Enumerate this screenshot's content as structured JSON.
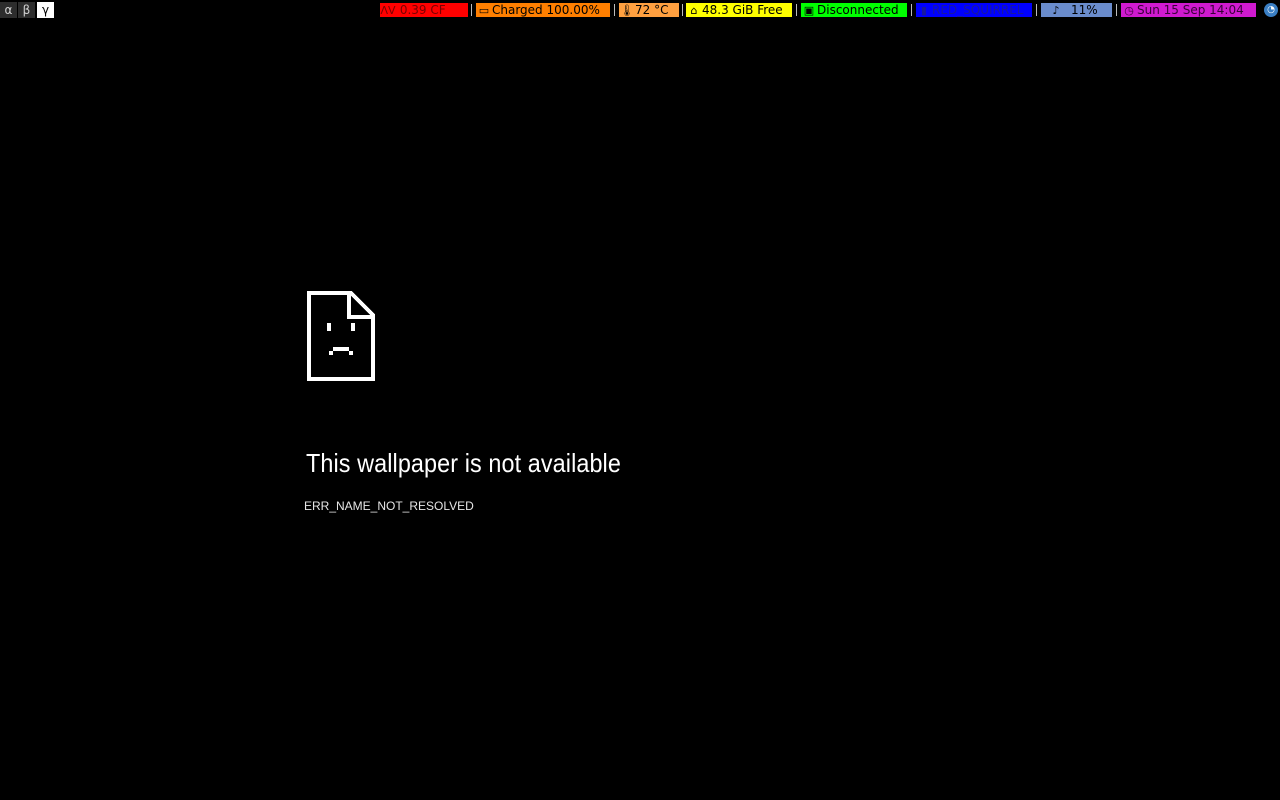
{
  "topbar": {
    "workspaces": [
      {
        "label": "α",
        "active": false
      },
      {
        "label": "β",
        "active": false
      },
      {
        "label": "γ",
        "active": true
      }
    ],
    "blocks": [
      {
        "name": "cpu-load",
        "icon": "pulse-icon",
        "glyph": "ᐱᐯ",
        "text": " 0.39 CF",
        "bg": "#ff0000",
        "fg": "#7a0000"
      },
      {
        "name": "battery",
        "icon": "battery-icon",
        "glyph": "▭",
        "text": "Charged 100.00%",
        "bg": "#ff7f00",
        "fg": "#000000"
      },
      {
        "name": "temperature",
        "icon": "thermometer-icon",
        "glyph": "🌡",
        "text": "72 °C",
        "bg": "#ffa040",
        "fg": "#000000"
      },
      {
        "name": "disk",
        "icon": "home-icon",
        "glyph": "⌂",
        "text": "48.3 GiB Free",
        "bg": "#ffff00",
        "fg": "#000000"
      },
      {
        "name": "network",
        "icon": "monitor-icon",
        "glyph": "▣",
        "text": "Disconnected",
        "bg": "#00ff00",
        "fg": "#000000"
      },
      {
        "name": "wifi",
        "icon": "signal-bars-icon",
        "glyph": "▮",
        "text": "RED_SQUIRREL",
        "bg": "#0000ff",
        "fg": "#1818a0"
      },
      {
        "name": "volume",
        "icon": "music-note-icon",
        "glyph": "♪",
        "text": "11%",
        "bg": "#6a8ccc",
        "fg": "#000000"
      },
      {
        "name": "clock",
        "icon": "clock-icon",
        "glyph": "◷",
        "text": "Sun 15 Sep 14:04",
        "bg": "#d01ad0",
        "fg": "#3a003a"
      }
    ],
    "tray_icon": "tray-app-icon"
  },
  "error": {
    "icon": "sad-document-icon",
    "title": "This wallpaper is not available",
    "code": "ERR_NAME_NOT_RESOLVED"
  }
}
